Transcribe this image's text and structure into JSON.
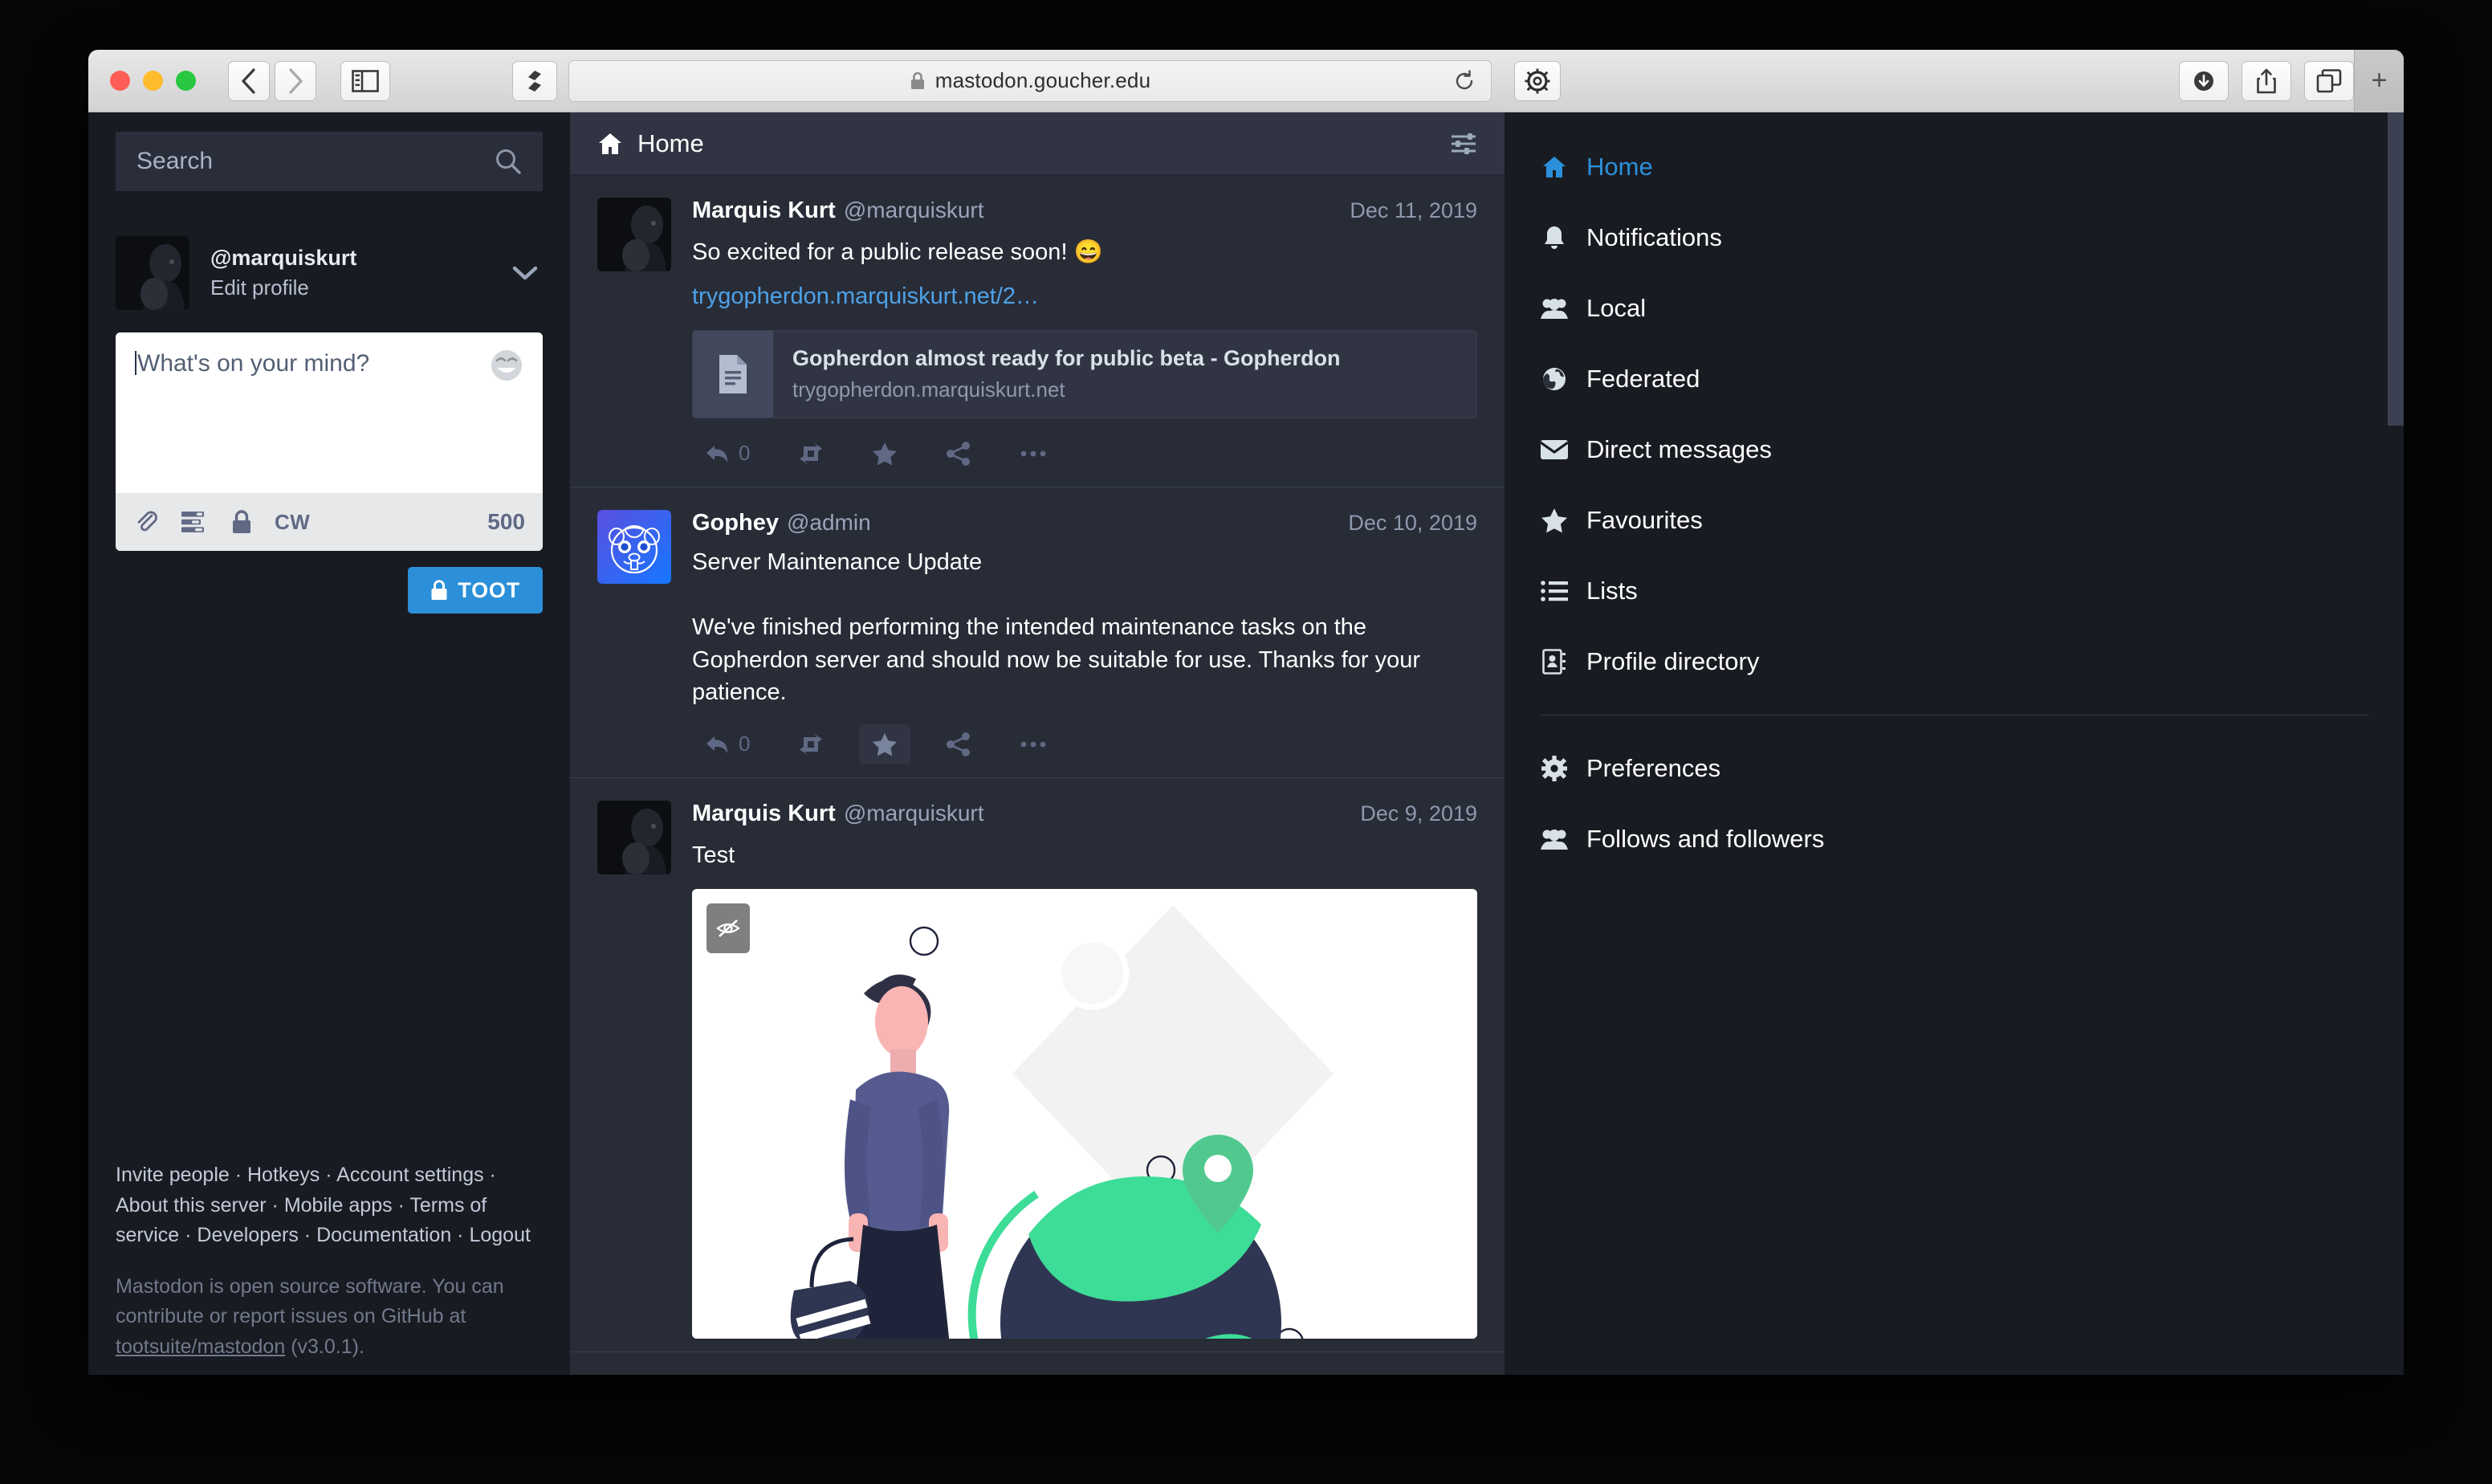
{
  "browser": {
    "traffic_lights": [
      "close",
      "minimize",
      "zoom"
    ],
    "back_label": "Back",
    "forward_label": "Forward",
    "sidebar_label": "Show sidebar",
    "shield_label": "Privacy report",
    "address": "mastodon.goucher.edu",
    "reload_label": "Reload",
    "gear_label": "Extension settings",
    "downloads_label": "Downloads",
    "share_label": "Share",
    "tabs_label": "Tab overview",
    "new_tab_label": "+"
  },
  "compose_column": {
    "search": {
      "placeholder": "Search",
      "value": ""
    },
    "account": {
      "handle": "@marquiskurt",
      "edit_profile": "Edit profile"
    },
    "composer": {
      "placeholder": "What's on your mind?",
      "value": "",
      "cw_label": "CW",
      "character_count": "500",
      "toot_button": "TOOT"
    },
    "footer": {
      "links": [
        "Invite people",
        "Hotkeys",
        "Account settings",
        "About this server",
        "Mobile apps",
        "Terms of service",
        "Developers",
        "Documentation",
        "Logout"
      ],
      "separator": " · ",
      "note_before": "Mastodon is open source software. You can contribute or report issues on GitHub at ",
      "note_link": "tootsuite/mastodon",
      "note_after": " (v3.0.1)."
    }
  },
  "timeline": {
    "header": {
      "title": "Home",
      "icon": "home-icon",
      "settings_icon": "sliders-icon"
    },
    "statuses": [
      {
        "display_name": "Marquis Kurt",
        "acct": "@marquiskurt",
        "timestamp": "Dec 11, 2019",
        "text": "So excited for a public release soon! ",
        "emoji": "😄",
        "link_text": "trygopherdon.marquiskurt.net/2…",
        "card": {
          "title": "Gopherdon almost ready for public beta - Gopherdon",
          "host": "trygopherdon.marquiskurt.net",
          "icon": "document-icon"
        },
        "actions": {
          "reply_count": "0",
          "reply_label": "Reply",
          "boost_label": "Boost",
          "favourite_label": "Favourite",
          "share_label": "Share",
          "more_label": "More"
        }
      },
      {
        "display_name": "Gophey",
        "acct": "@admin",
        "timestamp": "Dec 10, 2019",
        "spoiler_text": "Server Maintenance Update",
        "body": "We've finished performing the intended maintenance tasks on the Gopherdon server and should now be suitable for use. Thanks for your patience.",
        "actions": {
          "reply_count": "0",
          "reply_label": "Reply",
          "boost_label": "Boost",
          "favourite_label": "Favourite",
          "share_label": "Share",
          "more_label": "More"
        }
      },
      {
        "display_name": "Marquis Kurt",
        "acct": "@marquiskurt",
        "timestamp": "Dec 9, 2019",
        "text": "Test",
        "media": {
          "hide_label": "Hide image",
          "hide_icon": "eye-slash-icon",
          "alt": "Illustration of a traveler with a bag beside a globe with a location pin"
        }
      }
    ]
  },
  "nav": {
    "items": [
      {
        "label": "Home",
        "icon": "home-icon",
        "active": true
      },
      {
        "label": "Notifications",
        "icon": "bell-icon",
        "active": false
      },
      {
        "label": "Local",
        "icon": "users-icon",
        "active": false
      },
      {
        "label": "Federated",
        "icon": "globe-icon",
        "active": false
      },
      {
        "label": "Direct messages",
        "icon": "envelope-icon",
        "active": false
      },
      {
        "label": "Favourites",
        "icon": "star-icon",
        "active": false
      },
      {
        "label": "Lists",
        "icon": "list-icon",
        "active": false
      },
      {
        "label": "Profile directory",
        "icon": "address-book-icon",
        "active": false
      }
    ],
    "items_secondary": [
      {
        "label": "Preferences",
        "icon": "gear-icon",
        "active": false
      },
      {
        "label": "Follows and followers",
        "icon": "users-icon",
        "active": false
      }
    ]
  },
  "colors": {
    "accent": "#2b90d9",
    "page_bg": "#191b22",
    "timeline_bg": "#282c37",
    "header_bg": "#313543",
    "text_primary": "#ffffff",
    "text_muted": "#9aa4b8",
    "link": "#4ea2e8"
  }
}
